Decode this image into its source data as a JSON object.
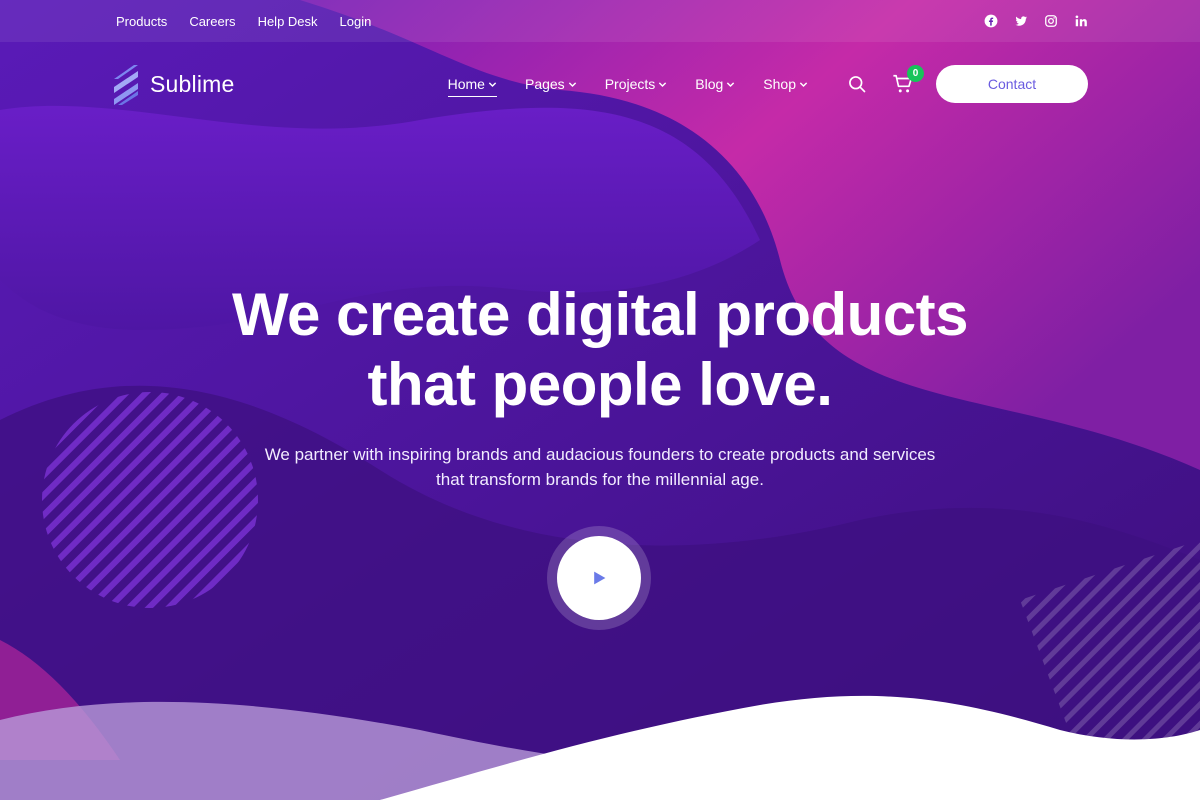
{
  "topbar": {
    "links": [
      "Products",
      "Careers",
      "Help Desk",
      "Login"
    ],
    "social": [
      "facebook-icon",
      "twitter-icon",
      "instagram-icon",
      "linkedin-icon"
    ]
  },
  "brand": {
    "name": "Sublime",
    "logo_icon": "stripes-logo-icon"
  },
  "nav": {
    "items": [
      {
        "label": "Home",
        "active": true
      },
      {
        "label": "Pages",
        "active": false
      },
      {
        "label": "Projects",
        "active": false
      },
      {
        "label": "Blog",
        "active": false
      },
      {
        "label": "Shop",
        "active": false
      }
    ],
    "cart_count": "0",
    "contact_label": "Contact"
  },
  "hero": {
    "title_line1": "We create digital products",
    "title_line2": "that people love.",
    "subtitle_line1": "We partner with inspiring brands and audacious founders to create products and services",
    "subtitle_line2": "that transform brands for the millennial age."
  },
  "colors": {
    "accent": "#6a5be0",
    "badge": "#18c45a",
    "purple_dark": "#4a1390",
    "magenta": "#c2249e"
  }
}
